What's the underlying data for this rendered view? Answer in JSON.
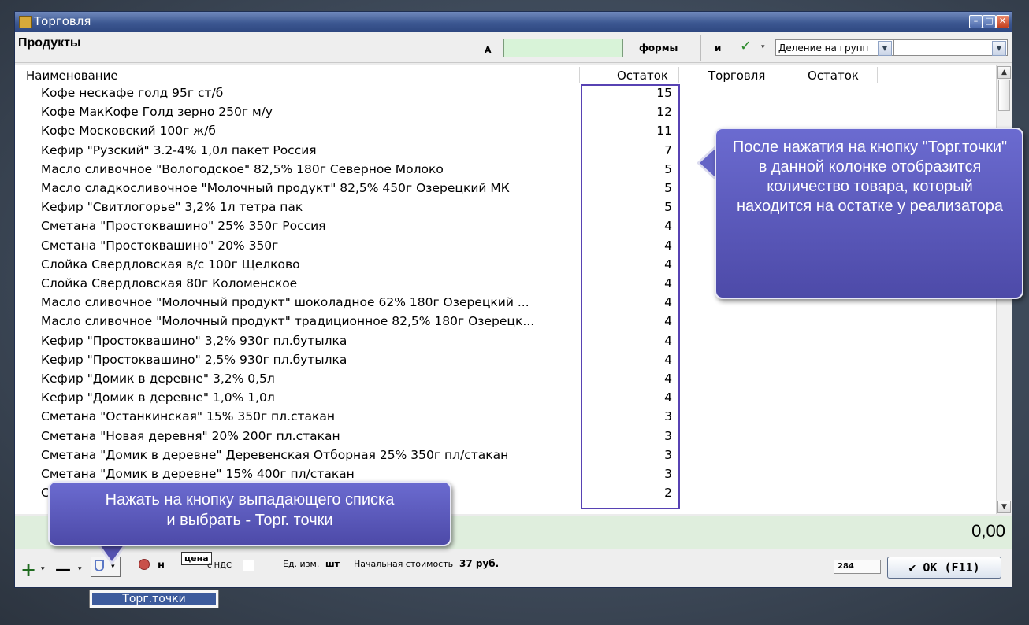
{
  "window": {
    "title": "Торговля",
    "minimize": "–",
    "maximize": "□",
    "close": "✕"
  },
  "toolbar": {
    "section_title": "Продукты",
    "search_marker": "А",
    "search_value": "",
    "forms_label": "формы",
    "and_button": "и",
    "check_glyph": "✓",
    "small_dropdown_glyph": "▾",
    "group_combo_value": "Деление на групп",
    "second_combo_value": ""
  },
  "grid": {
    "columns": [
      "Наименование",
      "Остаток",
      "Торговля",
      "Остаток"
    ],
    "rows": [
      {
        "name": "Кофе нескафе голд 95г ст/б",
        "stock": "15"
      },
      {
        "name": "Кофе МакКофе Голд зерно 250г м/у",
        "stock": "12"
      },
      {
        "name": "Кофе Московский 100г ж/б",
        "stock": "11"
      },
      {
        "name": "Кефир \"Рузский\" 3.2-4% 1,0л пакет Россия",
        "stock": "7"
      },
      {
        "name": "Масло сливочное \"Вологодское\" 82,5% 180г Северное Молоко",
        "stock": "5"
      },
      {
        "name": "Масло сладкосливочное \"Молочный продукт\" 82,5% 450г Озерецкий МК",
        "stock": "5"
      },
      {
        "name": "Кефир \"Свитлогорье\" 3,2% 1л тетра пак",
        "stock": "5"
      },
      {
        "name": "Сметана \"Простоквашино\" 25% 350г Россия",
        "stock": "4"
      },
      {
        "name": "Сметана \"Простоквашино\" 20% 350г",
        "stock": "4"
      },
      {
        "name": "Слойка Свердловская в/с 100г Щелково",
        "stock": "4"
      },
      {
        "name": "Слойка Свердловская 80г Коломенское",
        "stock": "4"
      },
      {
        "name": "Масло сливочное \"Молочный продукт\" шоколадное 62% 180г Озерецкий ...",
        "stock": "4"
      },
      {
        "name": "Масло сливочное \"Молочный продукт\" традиционное 82,5% 180г Озерецк...",
        "stock": "4"
      },
      {
        "name": "Кефир \"Простоквашино\" 3,2% 930г пл.бутылка",
        "stock": "4"
      },
      {
        "name": "Кефир \"Простоквашино\" 2,5% 930г пл.бутылка",
        "stock": "4"
      },
      {
        "name": "Кефир \"Домик в деревне\" 3,2% 0,5л",
        "stock": "4"
      },
      {
        "name": "Кефир \"Домик в деревне\" 1,0% 1,0л",
        "stock": "4"
      },
      {
        "name": "Сметана \"Останкинская\" 15% 350г пл.стакан",
        "stock": "3"
      },
      {
        "name": "Сметана \"Новая деревня\" 20% 200г пл.стакан",
        "stock": "3"
      },
      {
        "name": "Сметана \"Домик в деревне\" Деревенская Отборная 25% 350г пл/стакан",
        "stock": "3"
      },
      {
        "name": "Сметана \"Домик в деревне\" 15% 400г пл/стакан",
        "stock": "3"
      },
      {
        "name": "С",
        "stock": "2"
      }
    ]
  },
  "total": {
    "value": "0,00"
  },
  "bottom": {
    "add_glyph": "+",
    "remove_glyph": "—",
    "dd_glyph": "▾",
    "h_label": "н",
    "price_label": "цена",
    "vat_label": "с НДС",
    "unit_label": "Ед. изм.",
    "unit_value": "шт",
    "cost_label": "Начальная стоимость",
    "cost_value": "37 руб.",
    "counter": "284",
    "ok_label": "✔ OK (F11)"
  },
  "popup": {
    "item": "Торг.точки"
  },
  "callouts": {
    "right": "После нажатия на  кнопку \"Торг.точки\" в данной колонке отобразится количество товара, который находится на остатке у реализатора",
    "left_line1": "Нажать на кнопку выпадающего списка",
    "left_line2": "и выбрать - Торг. точки"
  },
  "colors": {
    "accent": "#5742b3",
    "callout": "#5b5abc",
    "total_bg": "#dfeedd",
    "search_bg": "#d8f3d8"
  }
}
